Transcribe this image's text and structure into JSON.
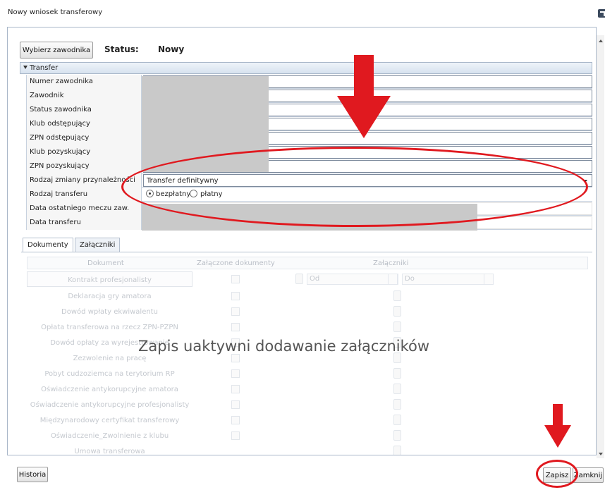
{
  "window": {
    "title": "Nowy wniosek transferowy"
  },
  "header": {
    "choose_player_button": "Wybierz zawodnika",
    "status_label": "Status:",
    "status_value": "Nowy"
  },
  "group": {
    "title": "Transfer"
  },
  "form": {
    "fields": [
      {
        "label": "Numer zawodnika",
        "value": ""
      },
      {
        "label": "Zawodnik",
        "value": ""
      },
      {
        "label": "Status zawodnika",
        "value": ""
      },
      {
        "label": "Klub odstępujący",
        "value": ""
      },
      {
        "label": "ZPN odstępujący",
        "value": ""
      },
      {
        "label": "Klub pozyskujący",
        "value": ""
      },
      {
        "label": "ZPN pozyskujący",
        "value": ""
      }
    ],
    "ownership_change": {
      "label": "Rodzaj zmiany przynależności",
      "value": "Transfer definitywny"
    },
    "transfer_type": {
      "label": "Rodzaj transferu",
      "option_free": "bezpłatny",
      "option_paid": "płatny",
      "selected": "bezpłatny"
    },
    "last_match_date": {
      "label": "Data ostatniego meczu zaw.",
      "value": ""
    },
    "transfer_date": {
      "label": "Data transferu",
      "value": ""
    }
  },
  "tabs": {
    "documents": "Dokumenty",
    "attachments": "Załączniki"
  },
  "grid": {
    "columns": {
      "document": "Dokument",
      "attached": "Załączone dokumenty",
      "attachments": "Załączniki"
    },
    "date_from": "Od",
    "date_to": "Do",
    "rows": [
      "Kontrakt profesjonalisty",
      "Deklaracja gry amatora",
      "Dowód wpłaty ekwiwalentu",
      "Opłata transferowa na rzecz ZPN-PZPN",
      "Dowód opłaty za wyrejestrowanie",
      "Zezwolenie na pracę",
      "Pobyt cudzoziemca na terytorium RP",
      "Oświadczenie antykorupcyjne amatora",
      "Oświadczenie antykorupcyjne profesjonalisty",
      "Międzynarodowy certyfikat transferowy",
      "Oświadczenie_Zwolnienie z klubu",
      "Umowa transferowa"
    ]
  },
  "overlay_message": "Zapis uaktywni dodawanie załączników",
  "footer": {
    "history_button": "Historia",
    "save_button": "Zapisz",
    "close_button": "Zamknij"
  },
  "colors": {
    "annotation_red": "#e0191f",
    "masked_gray": "#c9c9c9"
  }
}
